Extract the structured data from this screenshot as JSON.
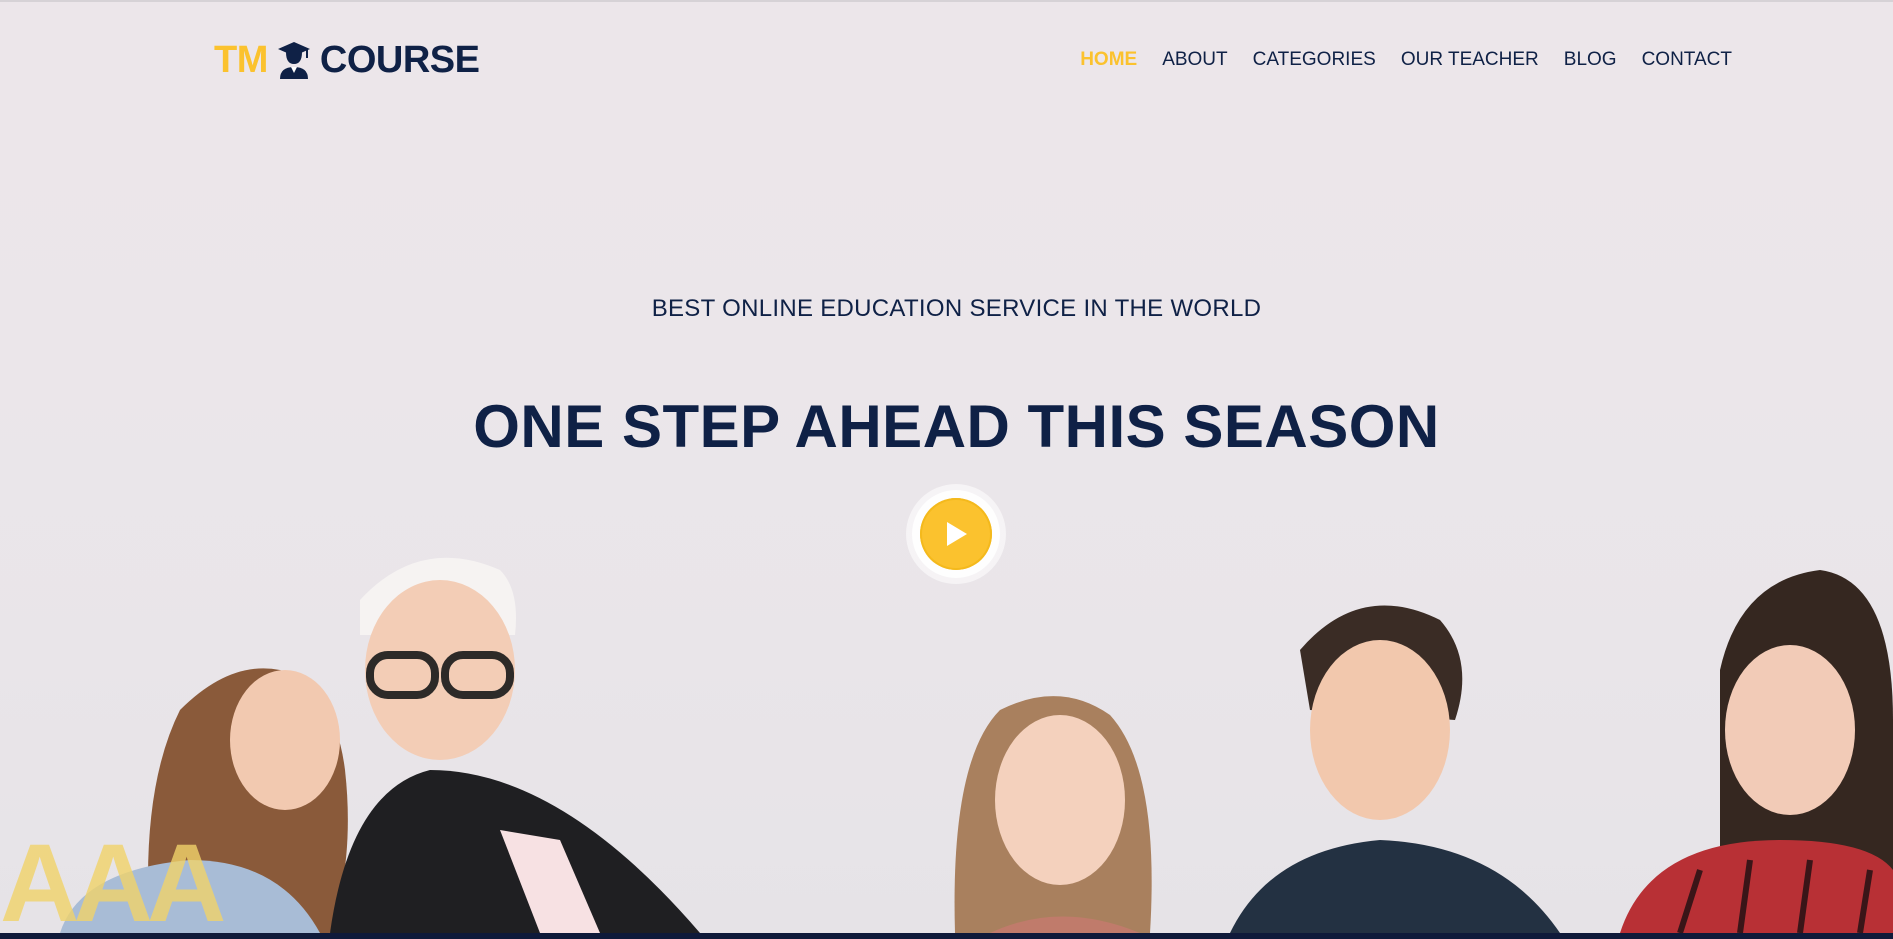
{
  "header": {
    "logo": {
      "part1": "TM",
      "part2": "COURSE",
      "icon": "graduate-icon"
    },
    "nav": [
      {
        "label": "HOME",
        "active": true
      },
      {
        "label": "ABOUT",
        "active": false
      },
      {
        "label": "CATEGORIES",
        "active": false
      },
      {
        "label": "OUR TEACHER",
        "active": false
      },
      {
        "label": "BLOG",
        "active": false
      },
      {
        "label": "CONTACT",
        "active": false
      }
    ]
  },
  "hero": {
    "subtitle": "BEST ONLINE EDUCATION SERVICE IN THE WORLD",
    "title": "ONE STEP AHEAD THIS SEASON",
    "play_icon": "play-icon"
  },
  "colors": {
    "accent": "#fbc22e",
    "navy": "#0f2146",
    "background": "#ebe6ea"
  }
}
